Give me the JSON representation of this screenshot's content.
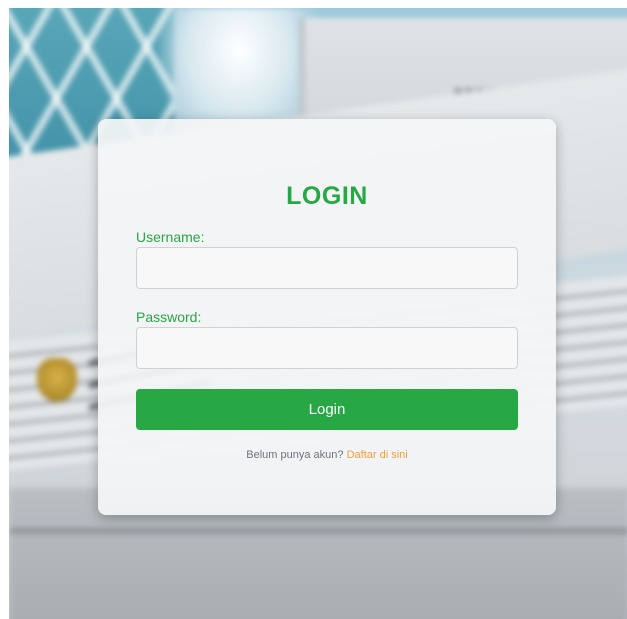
{
  "login": {
    "title": "LOGIN",
    "username_label": "Username:",
    "username_value": "",
    "password_label": "Password:",
    "password_value": "",
    "submit_label": "Login",
    "register_prompt": "Belum punya akun?",
    "register_link": "Daftar di sini"
  },
  "colors": {
    "accent": "#28a745",
    "link": "#f0a040",
    "muted_text": "#6c757d"
  }
}
